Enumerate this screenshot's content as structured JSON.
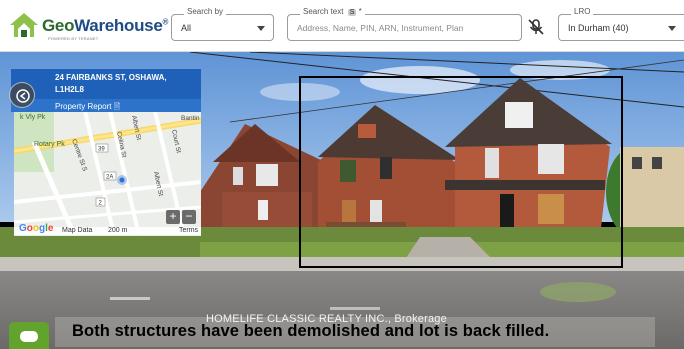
{
  "header": {
    "logo_geo": "Geo",
    "logo_warehouse": "Warehouse",
    "logo_reg": "®",
    "logo_tagline": "POWERED BY TERANET",
    "search_by": {
      "legend": "Search by",
      "value": "All"
    },
    "search_text": {
      "legend": "Search text",
      "legend_badge": "S",
      "required_mark": "*",
      "placeholder": "Address, Name, PIN, ARN, Instrument, Plan"
    },
    "lro": {
      "legend": "LRO",
      "value": "In Durham (40)"
    }
  },
  "map_panel": {
    "address_line1": "24 FAIRBANKS ST, OSHAWA,",
    "address_line2": "L1H2L8",
    "property_report_label": "Property Report",
    "map_labels": {
      "road_kv": "k Vly Pk",
      "rotary": "Rotary Pk",
      "centre": "Centre St S",
      "albert": "Albert St",
      "celina": "Celina St",
      "court": "Court St",
      "bantin": "Bantin",
      "albert2": "Albert St",
      "route_39": "39",
      "route_2a": "2A",
      "route_2": "2"
    },
    "map_footer": {
      "google": "Google",
      "map_data": "Map Data",
      "scale": "200 m",
      "terms": "Terms"
    },
    "zoom_in": "+",
    "zoom_out": "−"
  },
  "photo": {
    "watermark": "HOMELIFE CLASSIC REALTY INC., Brokerage",
    "caption": "Both structures have been demolished and lot is back filled."
  },
  "colors": {
    "brand_green": "#2b6a2f",
    "brand_blue": "#1f4b85",
    "panel_blue": "#1f60b8",
    "chat_green": "#62a32e"
  },
  "icons": [
    "geowarehouse-logo-icon",
    "caret-down-icon",
    "mic-off-icon",
    "back-arrow-icon",
    "document-icon",
    "chat-icon"
  ]
}
